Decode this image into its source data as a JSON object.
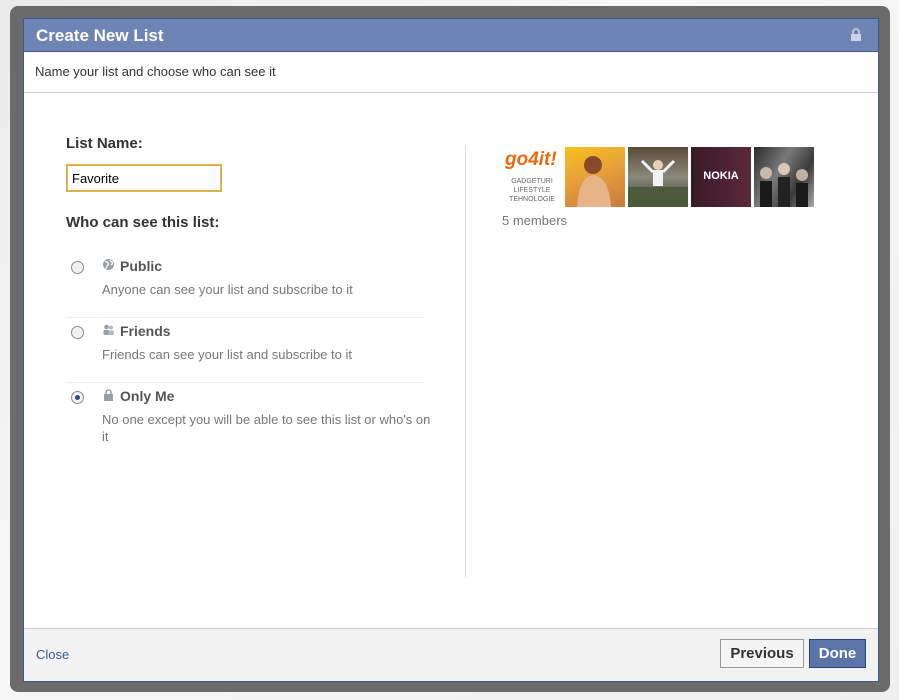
{
  "dialog": {
    "title": "Create New List",
    "subtitle": "Name your list and choose who can see it"
  },
  "form": {
    "list_name_label": "List Name:",
    "list_name_value": "Favorite",
    "who_label": "Who can see this list:"
  },
  "options": [
    {
      "title": "Public",
      "description": "Anyone can see your list and subscribe to it",
      "icon": "globe-icon",
      "selected": false
    },
    {
      "title": "Friends",
      "description": "Friends can see your list and subscribe to it",
      "icon": "friends-icon",
      "selected": false
    },
    {
      "title": "Only Me",
      "description": "No one except you will be able to see this list or who's on it",
      "icon": "lock-icon",
      "selected": true
    }
  ],
  "members": {
    "count_text": "5 members",
    "thumb1_brand": "go4it!",
    "thumb1_tagline": "GADGETURI LIFESTYLE TEHNOLOGIE",
    "thumb4_brand": "NOKIA"
  },
  "footer": {
    "close_label": "Close",
    "previous_label": "Previous",
    "done_label": "Done"
  },
  "colors": {
    "title_bar": "#6d84b4",
    "brand_blue": "#3b5998",
    "input_focus": "#e0b34a"
  }
}
